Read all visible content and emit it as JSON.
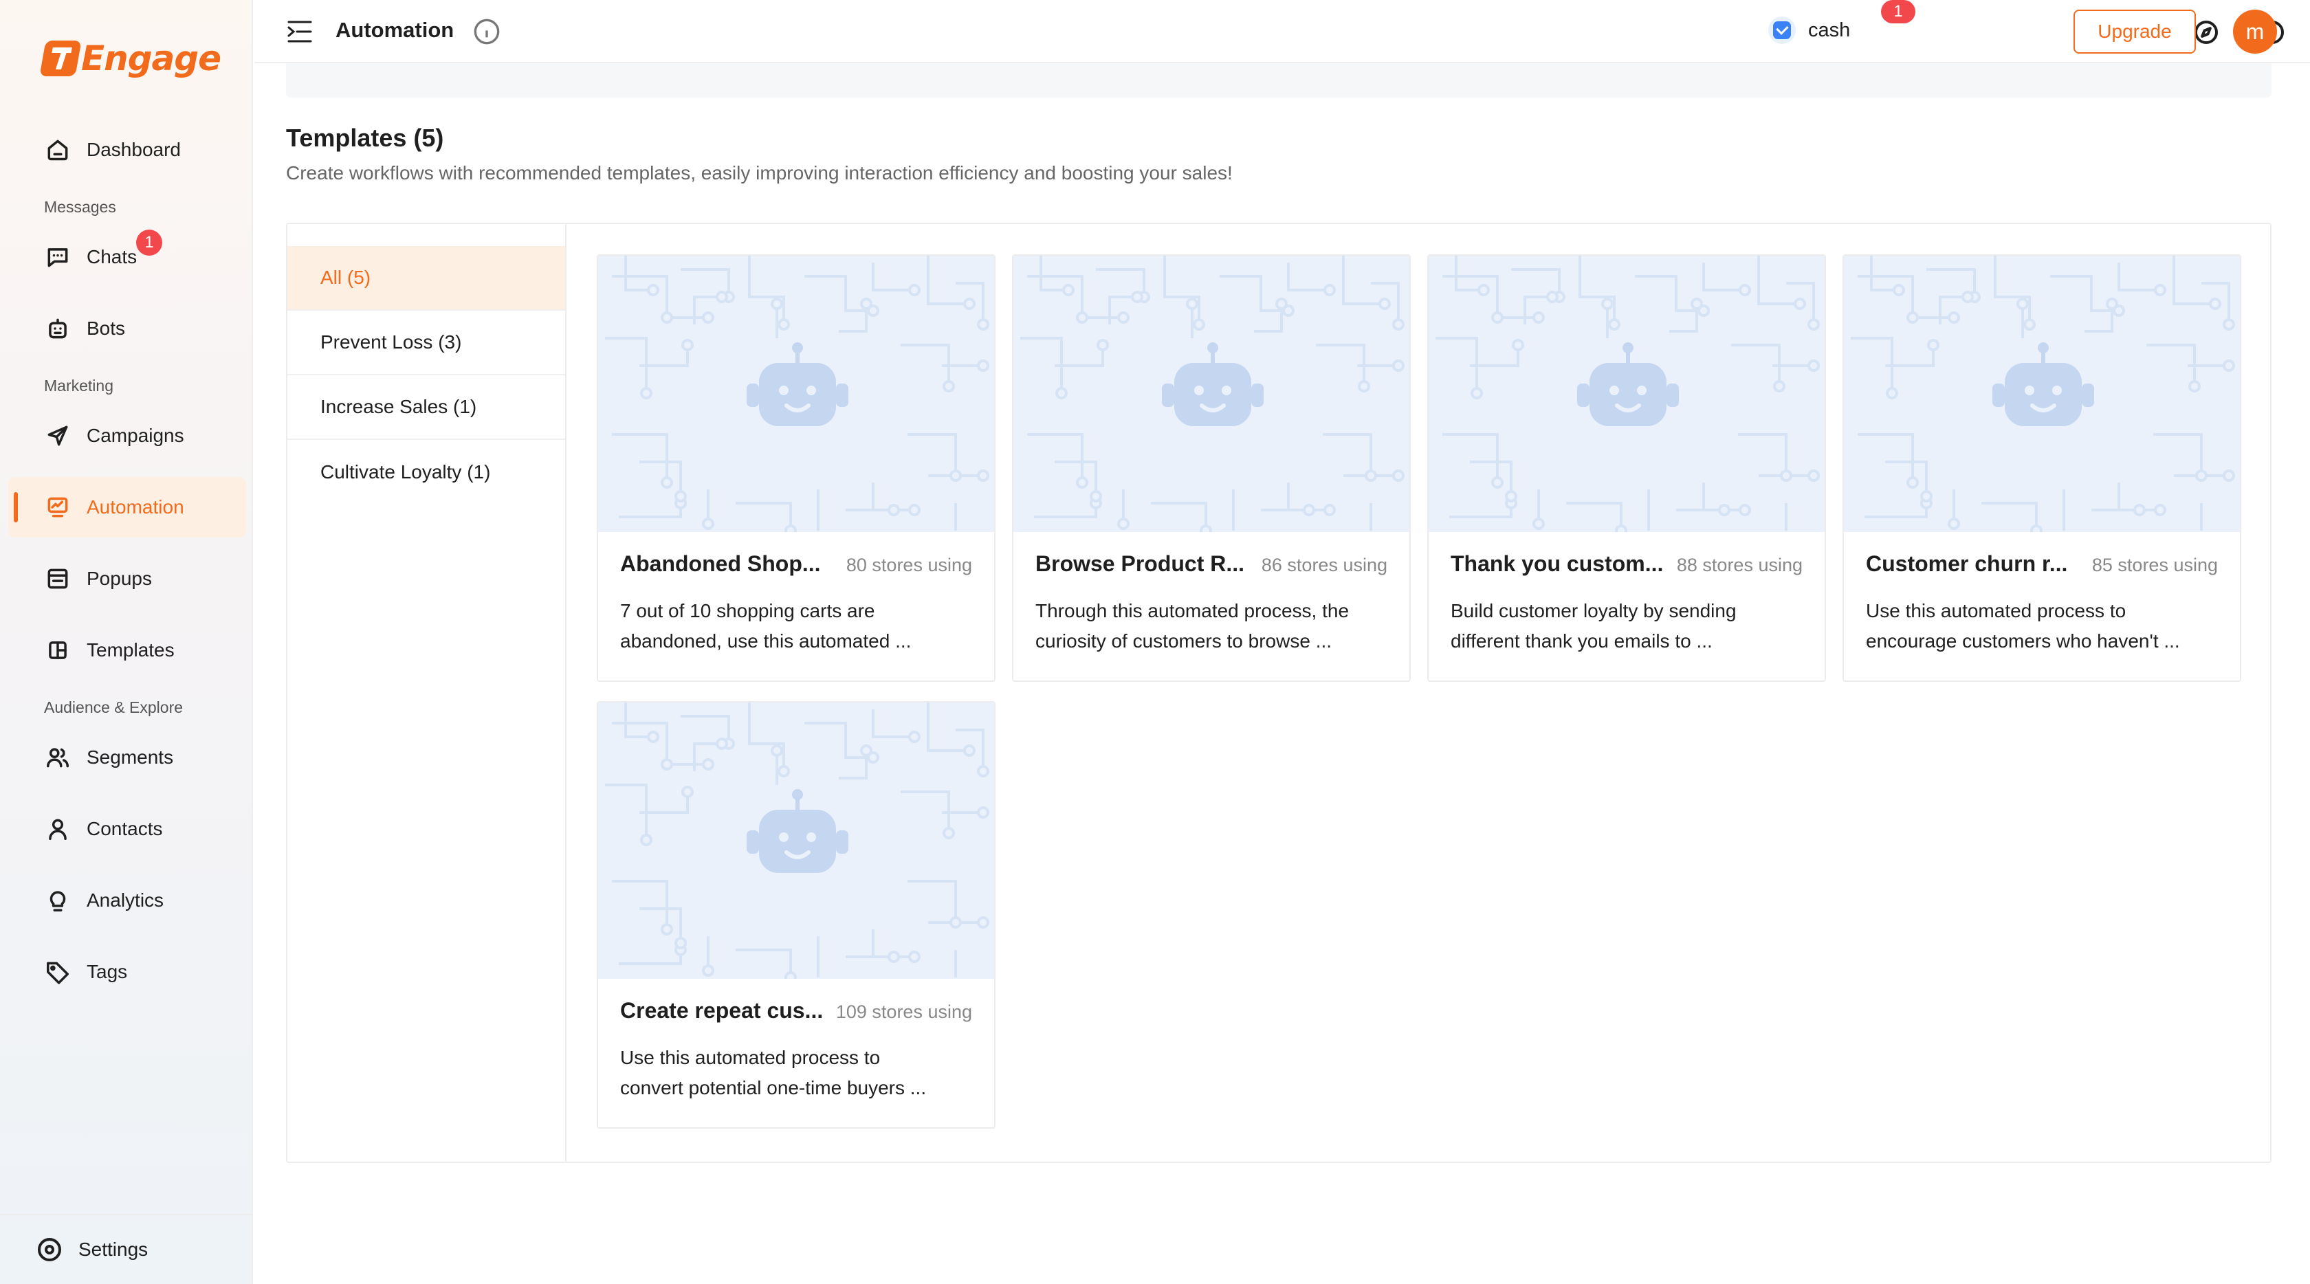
{
  "brand": {
    "name": "Engage",
    "accent": "#f26a1b"
  },
  "sidebar": {
    "items": [
      {
        "label": "Dashboard",
        "icon": "home-icon"
      },
      {
        "section": "Messages"
      },
      {
        "label": "Chats",
        "icon": "chat-icon",
        "badge": "1"
      },
      {
        "label": "Bots",
        "icon": "bot-icon"
      },
      {
        "section": "Marketing"
      },
      {
        "label": "Campaigns",
        "icon": "send-icon"
      },
      {
        "label": "Automation",
        "icon": "automation-icon",
        "active": true
      },
      {
        "label": "Popups",
        "icon": "popup-icon"
      },
      {
        "label": "Templates",
        "icon": "templates-icon"
      },
      {
        "section": "Audience & Explore"
      },
      {
        "label": "Segments",
        "icon": "segments-icon"
      },
      {
        "label": "Contacts",
        "icon": "contact-icon"
      },
      {
        "label": "Analytics",
        "icon": "bulb-icon"
      },
      {
        "label": "Tags",
        "icon": "tag-icon"
      }
    ],
    "settings_label": "Settings"
  },
  "header": {
    "title": "Automation",
    "store_name": "cash",
    "notification_badge": "1",
    "upgrade_label": "Upgrade",
    "avatar_initial": "m"
  },
  "templates": {
    "title": "Templates (5)",
    "subtitle": "Create workflows with recommended templates, easily improving interaction efficiency and boosting your sales!",
    "categories": [
      {
        "label": "All (5)",
        "active": true
      },
      {
        "label": "Prevent Loss (3)"
      },
      {
        "label": "Increase Sales (1)"
      },
      {
        "label": "Cultivate Loyalty (1)"
      }
    ],
    "cards": [
      {
        "title": "Abandoned Shop...",
        "count": "80 stores using",
        "desc1": "7 out of 10 shopping carts are",
        "desc2": "abandoned, use this automated ..."
      },
      {
        "title": "Browse Product R...",
        "count": "86 stores using",
        "desc1": "Through this automated process, the",
        "desc2": "curiosity of customers to browse ..."
      },
      {
        "title": "Thank you custom...",
        "count": "88 stores using",
        "desc1": "Build customer loyalty by sending",
        "desc2": "different thank you emails to ..."
      },
      {
        "title": "Customer churn r...",
        "count": "85 stores using",
        "desc1": "Use this automated process to",
        "desc2": "encourage customers who haven't ..."
      },
      {
        "title": "Create repeat cus...",
        "count": "109 stores using",
        "desc1": "Use this automated process to",
        "desc2": "convert potential one-time buyers ..."
      }
    ]
  }
}
